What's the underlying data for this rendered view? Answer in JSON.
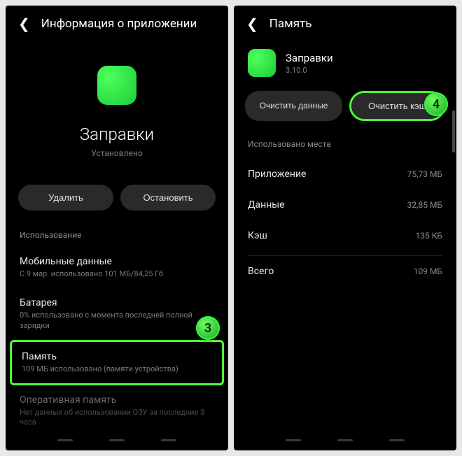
{
  "left": {
    "header": "Информация о приложении",
    "app_name": "Заправки",
    "app_status": "Установлено",
    "btn_uninstall": "Удалить",
    "btn_stop": "Остановить",
    "section_usage": "Использование",
    "items": [
      {
        "title": "Мобильные данные",
        "sub": "С 9 мар. использовано 101 МБ/84,25 Гб"
      },
      {
        "title": "Батарея",
        "sub": "0% использовано с момента последней полной зарядки"
      },
      {
        "title": "Память",
        "sub": "109 МБ использовано (памяти устройства)"
      },
      {
        "title": "Оперативная память",
        "sub": "Нет данных об использовании ОЗУ за последние 3 часа"
      }
    ],
    "step": "3"
  },
  "right": {
    "header": "Память",
    "app_name": "Заправки",
    "app_version": "3.10.0",
    "btn_clear_data": "Очистить данные",
    "btn_clear_cache": "Очистить кэш",
    "section_usage": "Использовано места",
    "rows": [
      {
        "key": "Приложение",
        "val": "75,73 МБ"
      },
      {
        "key": "Данные",
        "val": "32,85 МБ"
      },
      {
        "key": "Кэш",
        "val": "135 КБ"
      },
      {
        "key": "Всего",
        "val": "109 МБ"
      }
    ],
    "step": "4"
  }
}
